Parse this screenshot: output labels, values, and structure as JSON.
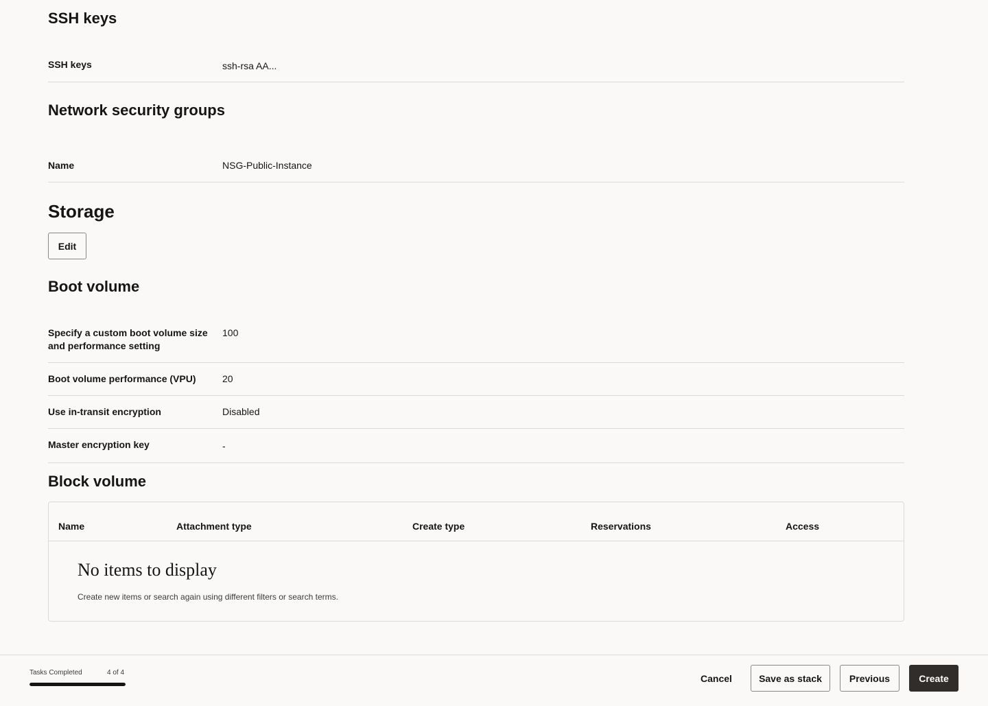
{
  "ssh_section": {
    "heading": "SSH keys",
    "rows": [
      {
        "label": "SSH keys",
        "value": "ssh-rsa AA..."
      }
    ]
  },
  "nsg_section": {
    "heading": "Network security groups",
    "rows": [
      {
        "label": "Name",
        "value": "NSG-Public-Instance"
      }
    ]
  },
  "storage_section": {
    "heading": "Storage",
    "edit_label": "Edit"
  },
  "boot_volume": {
    "heading": "Boot volume",
    "rows": [
      {
        "label": "Specify a custom boot volume size and performance setting",
        "value": "100"
      },
      {
        "label": "Boot volume performance (VPU)",
        "value": "20"
      },
      {
        "label": "Use in-transit encryption",
        "value": "Disabled"
      },
      {
        "label": "Master encryption key",
        "value": "-"
      }
    ]
  },
  "block_volume": {
    "heading": "Block volume",
    "columns": [
      "Name",
      "Attachment type",
      "Create type",
      "Reservations",
      "Access"
    ],
    "empty_title": "No items to display",
    "empty_subtitle": "Create new items or search again using different filters or search terms."
  },
  "footer": {
    "tasks_label": "Tasks Completed",
    "tasks_count": "4 of 4",
    "progress_fraction": 1.0,
    "cancel_label": "Cancel",
    "save_stack_label": "Save as stack",
    "previous_label": "Previous",
    "create_label": "Create"
  }
}
